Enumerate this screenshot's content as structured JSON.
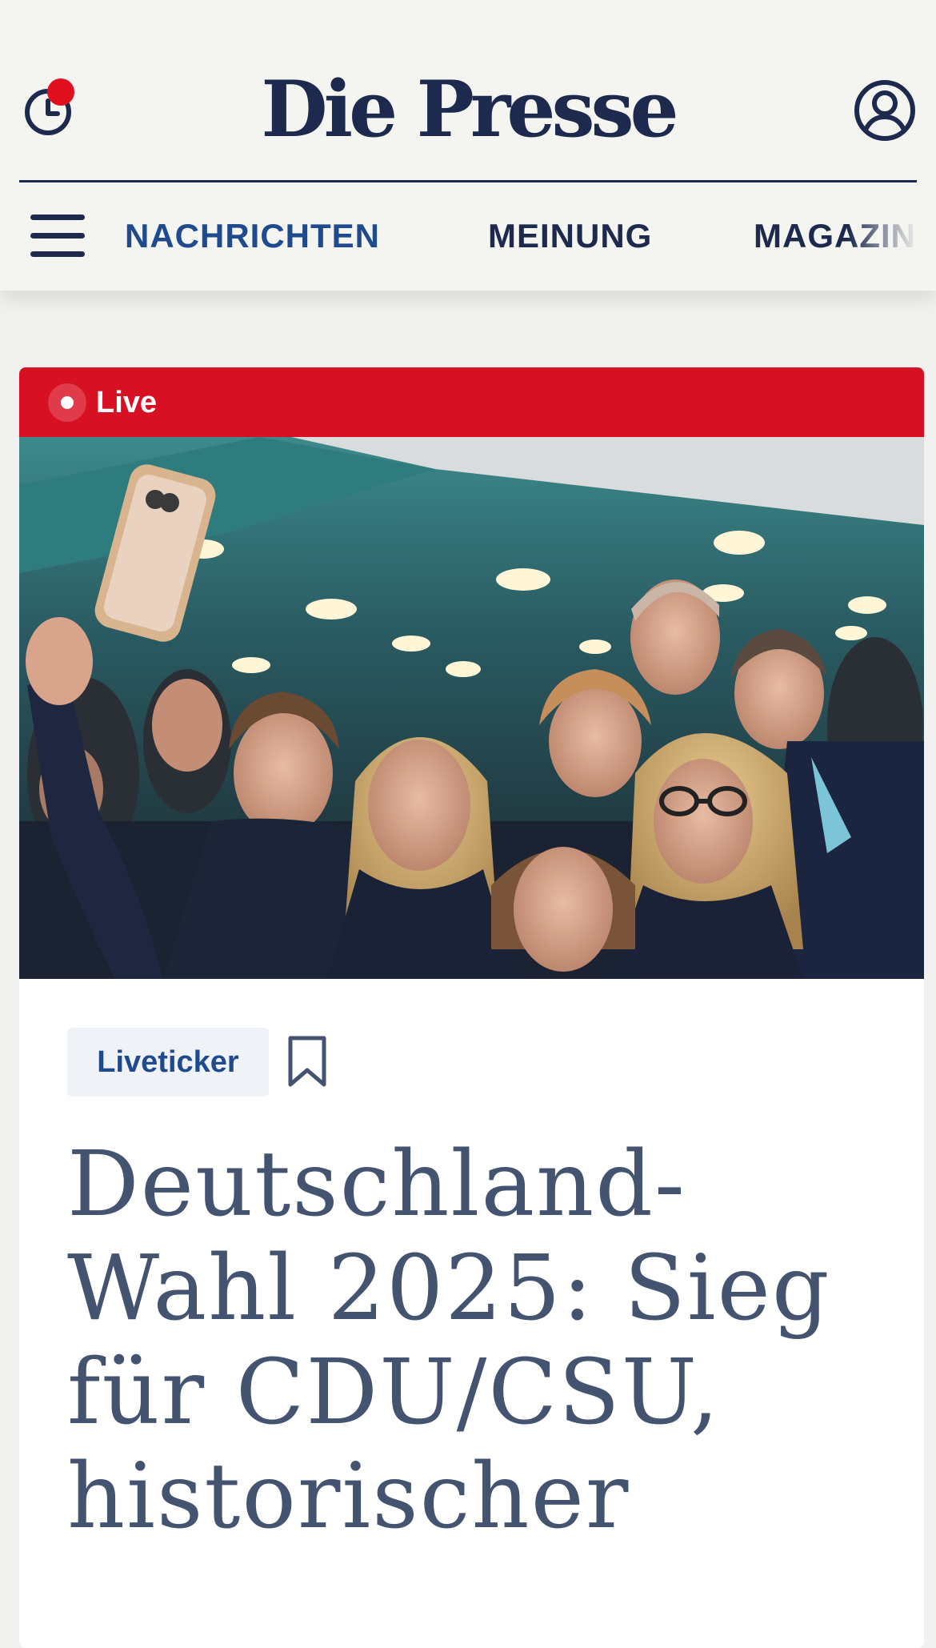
{
  "header": {
    "logo": "Die Presse",
    "history_icon": "clock-icon",
    "account_icon": "user-circle-icon",
    "notification_color": "#e0101f"
  },
  "nav": {
    "menu_icon": "hamburger-icon",
    "items": [
      {
        "label": "NACHRICHTEN",
        "active": true
      },
      {
        "label": "MEINUNG",
        "active": false
      },
      {
        "label": "MAGAZIN",
        "active": false
      }
    ]
  },
  "article": {
    "live_label": "Live",
    "live_color": "#d81024",
    "image_alt": "Jubelnde Anhänger machen ein Selfie",
    "tag": "Liveticker",
    "bookmark_icon": "bookmark-icon",
    "headline": "Deutschland-Wahl 2025: Sieg für CDU/CSU, historischer"
  },
  "colors": {
    "brand_navy": "#1d2a4d",
    "nav_active": "#1f4b8e",
    "headline": "#435370"
  }
}
